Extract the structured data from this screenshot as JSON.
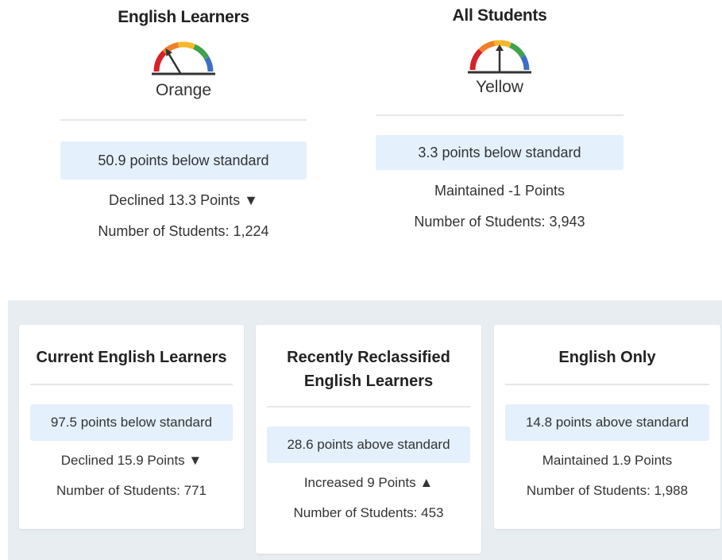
{
  "top": {
    "english_learners": {
      "title": "English Learners",
      "color_label": "Orange",
      "status": "50.9 points below standard",
      "change": "Declined 13.3 Points ▼",
      "count": "Number of Students: 1,224"
    },
    "all_students": {
      "title": "All Students",
      "color_label": "Yellow",
      "status": "3.3 points below standard",
      "change": "Maintained -1 Points",
      "count": "Number of Students: 3,943"
    }
  },
  "groups": [
    {
      "title": "Current English Learners",
      "status": "97.5 points below standard",
      "change": "Declined 15.9 Points ▼",
      "count": "Number of Students: 771"
    },
    {
      "title": "Recently Reclassified English Learners",
      "status": "28.6 points above standard",
      "change": "Increased 9 Points ▲",
      "count": "Number of Students: 453"
    },
    {
      "title": "English Only",
      "status": "14.8 points above standard",
      "change": "Maintained 1.9 Points",
      "count": "Number of Students: 1,988"
    }
  ],
  "colors": {
    "red": "#d6202a",
    "orange": "#f07f2a",
    "yellow": "#f5b82a",
    "green": "#3fa34d",
    "blue": "#3d6fc6",
    "status_bg": "#e4f0fc",
    "panel_bg": "#e8edf1"
  },
  "icons": {
    "gauge": "dashboard-gauge-icon"
  }
}
